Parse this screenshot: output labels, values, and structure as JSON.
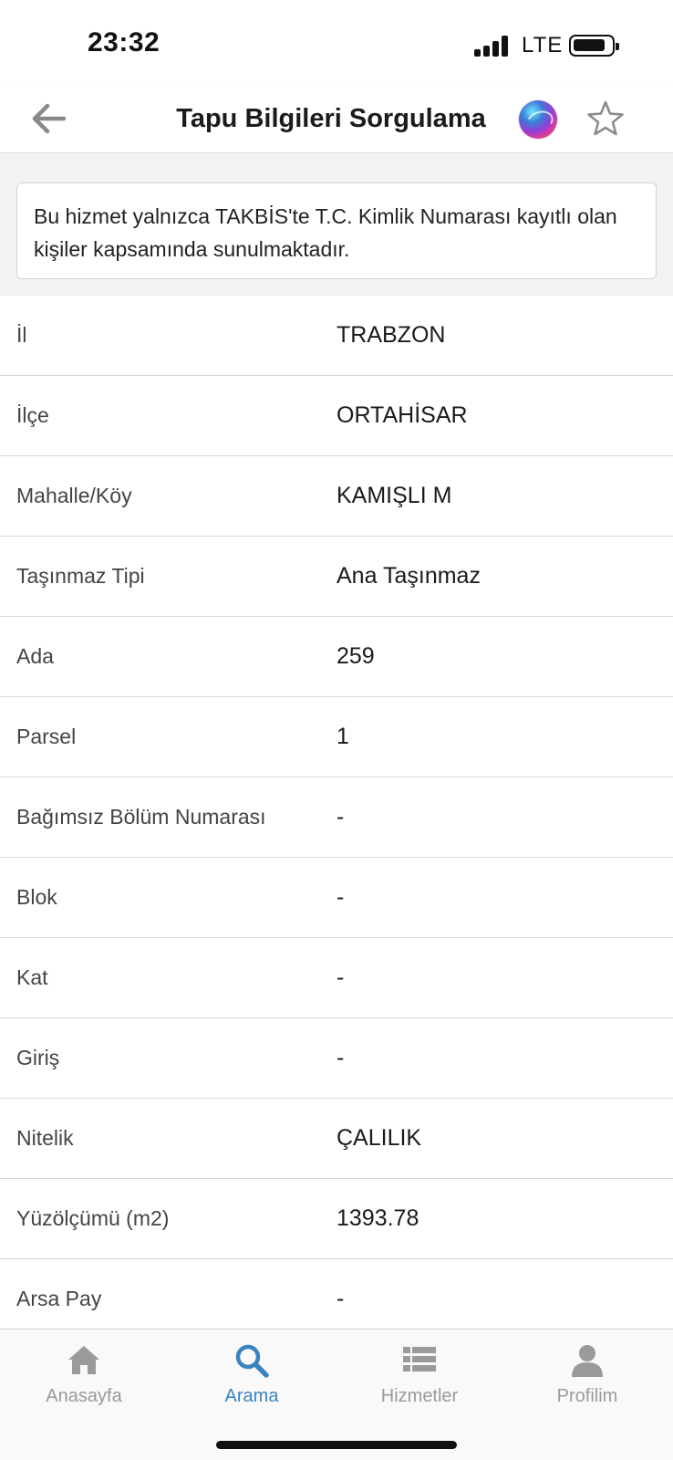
{
  "status_bar": {
    "time": "23:32",
    "network": "LTE",
    "icons": [
      "signal-icon",
      "battery-icon"
    ]
  },
  "header": {
    "title": "Tapu Bilgileri Sorgulama",
    "icons": [
      "back-arrow-icon",
      "siri-icon",
      "star-icon"
    ]
  },
  "notice": {
    "text": "Bu hizmet yalnızca TAKBİS'te T.C. Kimlik Numarası kayıtlı olan kişiler kapsamında sunulmaktadır."
  },
  "details": [
    {
      "label": "İl",
      "value": "TRABZON"
    },
    {
      "label": "İlçe",
      "value": "ORTAHİSAR"
    },
    {
      "label": "Mahalle/Köy",
      "value": "KAMIŞLI M"
    },
    {
      "label": "Taşınmaz Tipi",
      "value": "Ana Taşınmaz"
    },
    {
      "label": "Ada",
      "value": "259"
    },
    {
      "label": "Parsel",
      "value": "1"
    },
    {
      "label": "Bağımsız Bölüm Numarası",
      "value": "-"
    },
    {
      "label": "Blok",
      "value": "-"
    },
    {
      "label": "Kat",
      "value": "-"
    },
    {
      "label": "Giriş",
      "value": "-"
    },
    {
      "label": "Nitelik",
      "value": "ÇALILIK"
    },
    {
      "label": "Yüzölçümü (m2)",
      "value": "1393.78"
    },
    {
      "label": "Arsa Pay",
      "value": "-"
    }
  ],
  "tabs": [
    {
      "label": "Anasayfa",
      "icon": "home-icon",
      "active": false
    },
    {
      "label": "Arama",
      "icon": "search-icon",
      "active": true
    },
    {
      "label": "Hizmetler",
      "icon": "list-icon",
      "active": false
    },
    {
      "label": "Profilim",
      "icon": "person-icon",
      "active": false
    }
  ],
  "colors": {
    "accent": "#3a83bf",
    "inactive_tab": "#9a9a9a",
    "notice_bg": "#f2f2f4"
  }
}
